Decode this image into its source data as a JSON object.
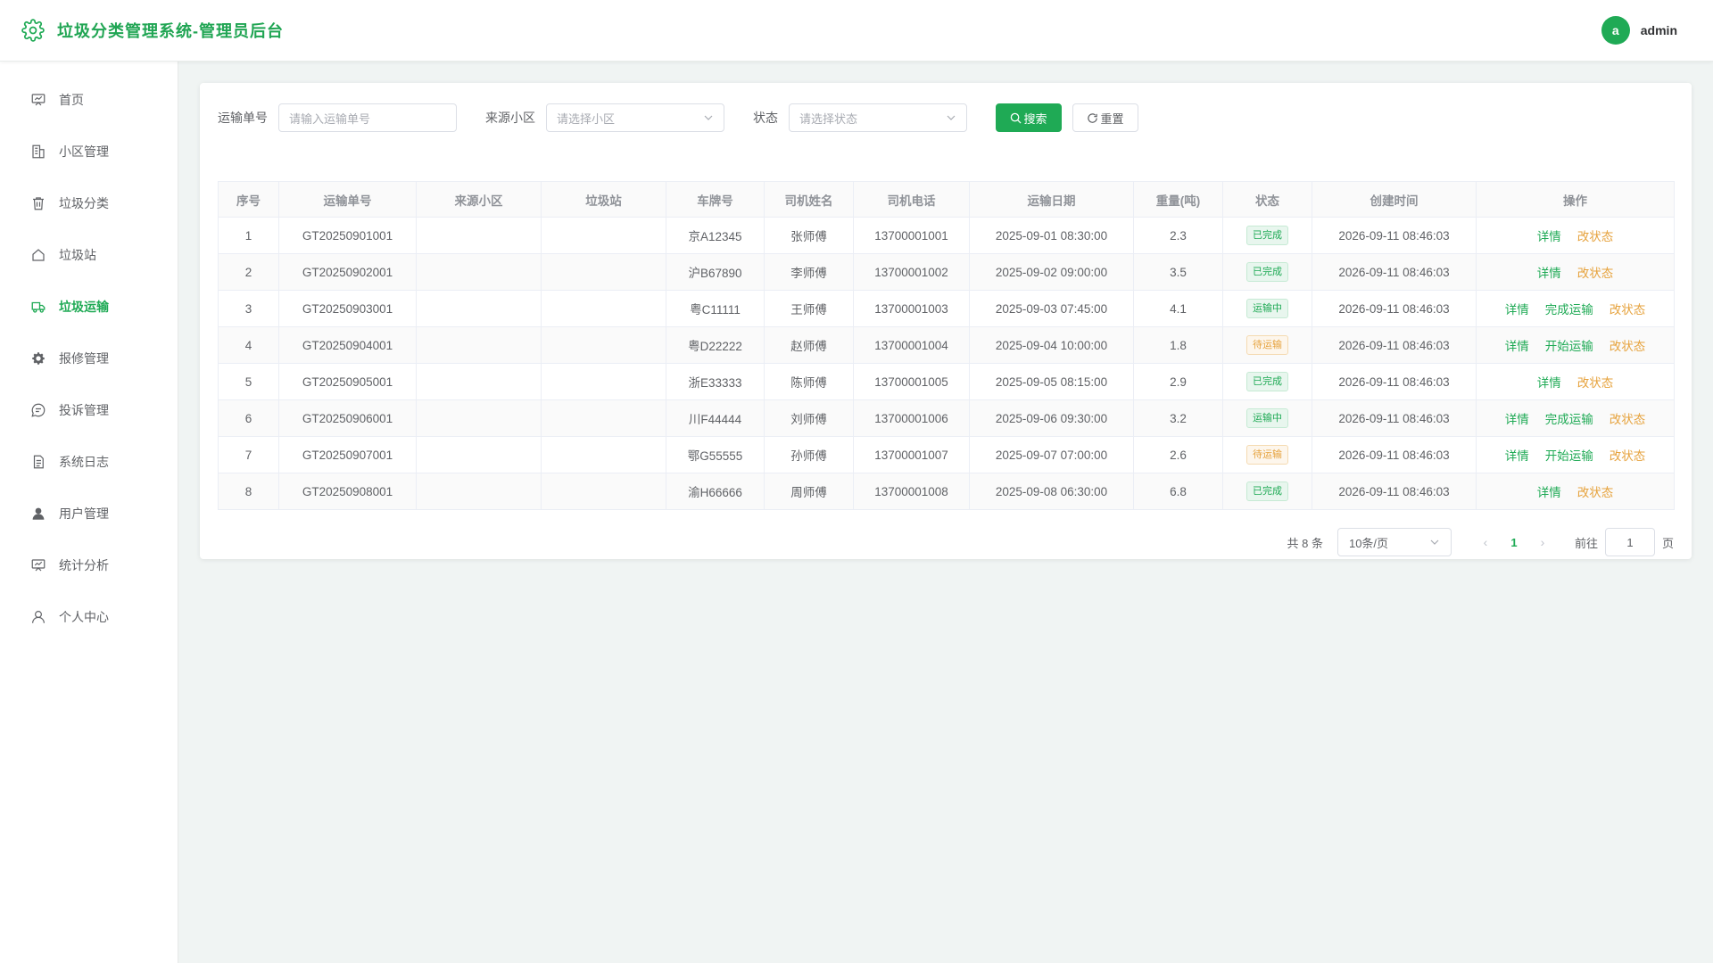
{
  "header": {
    "title": "垃圾分类管理系统-管理员后台",
    "user_initial": "a",
    "username": "admin"
  },
  "sidebar": {
    "items": [
      {
        "label": "首页",
        "icon": "dashboard-icon"
      },
      {
        "label": "小区管理",
        "icon": "building-icon"
      },
      {
        "label": "垃圾分类",
        "icon": "trash-icon"
      },
      {
        "label": "垃圾站",
        "icon": "house-icon"
      },
      {
        "label": "垃圾运输",
        "icon": "truck-icon",
        "active": true
      },
      {
        "label": "报修管理",
        "icon": "gear-icon"
      },
      {
        "label": "投诉管理",
        "icon": "chat-icon"
      },
      {
        "label": "系统日志",
        "icon": "document-icon"
      },
      {
        "label": "用户管理",
        "icon": "user-filled-icon"
      },
      {
        "label": "统计分析",
        "icon": "chart-icon"
      },
      {
        "label": "个人中心",
        "icon": "user-icon"
      }
    ]
  },
  "filters": {
    "transport_no_label": "运输单号",
    "transport_no_placeholder": "请输入运输单号",
    "community_label": "来源小区",
    "community_placeholder": "请选择小区",
    "status_label": "状态",
    "status_placeholder": "请选择状态",
    "search_label": "搜索",
    "reset_label": "重置"
  },
  "table": {
    "columns": [
      "序号",
      "运输单号",
      "来源小区",
      "垃圾站",
      "车牌号",
      "司机姓名",
      "司机电话",
      "运输日期",
      "重量(吨)",
      "状态",
      "创建时间",
      "操作"
    ],
    "rows": [
      {
        "no": "1",
        "order": "GT20250901001",
        "community": "",
        "station": "",
        "plate": "京A12345",
        "driver": "张师傅",
        "phone": "13700001001",
        "date": "2025-09-01 08:30:00",
        "weight": "2.3",
        "status": "已完成",
        "status_type": "done",
        "created": "2026-09-11 08:46:03",
        "ops": [
          "详情",
          "改状态"
        ]
      },
      {
        "no": "2",
        "order": "GT20250902001",
        "community": "",
        "station": "",
        "plate": "沪B67890",
        "driver": "李师傅",
        "phone": "13700001002",
        "date": "2025-09-02 09:00:00",
        "weight": "3.5",
        "status": "已完成",
        "status_type": "done",
        "created": "2026-09-11 08:46:03",
        "ops": [
          "详情",
          "改状态"
        ]
      },
      {
        "no": "3",
        "order": "GT20250903001",
        "community": "",
        "station": "",
        "plate": "粤C11111",
        "driver": "王师傅",
        "phone": "13700001003",
        "date": "2025-09-03 07:45:00",
        "weight": "4.1",
        "status": "运输中",
        "status_type": "moving",
        "created": "2026-09-11 08:46:03",
        "ops": [
          "详情",
          "完成运输",
          "改状态"
        ]
      },
      {
        "no": "4",
        "order": "GT20250904001",
        "community": "",
        "station": "",
        "plate": "粤D22222",
        "driver": "赵师傅",
        "phone": "13700001004",
        "date": "2025-09-04 10:00:00",
        "weight": "1.8",
        "status": "待运输",
        "status_type": "wait",
        "created": "2026-09-11 08:46:03",
        "ops": [
          "详情",
          "开始运输",
          "改状态"
        ]
      },
      {
        "no": "5",
        "order": "GT20250905001",
        "community": "",
        "station": "",
        "plate": "浙E33333",
        "driver": "陈师傅",
        "phone": "13700001005",
        "date": "2025-09-05 08:15:00",
        "weight": "2.9",
        "status": "已完成",
        "status_type": "done",
        "created": "2026-09-11 08:46:03",
        "ops": [
          "详情",
          "改状态"
        ]
      },
      {
        "no": "6",
        "order": "GT20250906001",
        "community": "",
        "station": "",
        "plate": "川F44444",
        "driver": "刘师傅",
        "phone": "13700001006",
        "date": "2025-09-06 09:30:00",
        "weight": "3.2",
        "status": "运输中",
        "status_type": "moving",
        "created": "2026-09-11 08:46:03",
        "ops": [
          "详情",
          "完成运输",
          "改状态"
        ]
      },
      {
        "no": "7",
        "order": "GT20250907001",
        "community": "",
        "station": "",
        "plate": "鄂G55555",
        "driver": "孙师傅",
        "phone": "13700001007",
        "date": "2025-09-07 07:00:00",
        "weight": "2.6",
        "status": "待运输",
        "status_type": "wait",
        "created": "2026-09-11 08:46:03",
        "ops": [
          "详情",
          "开始运输",
          "改状态"
        ]
      },
      {
        "no": "8",
        "order": "GT20250908001",
        "community": "",
        "station": "",
        "plate": "渝H66666",
        "driver": "周师傅",
        "phone": "13700001008",
        "date": "2025-09-08 06:30:00",
        "weight": "6.8",
        "status": "已完成",
        "status_type": "done",
        "created": "2026-09-11 08:46:03",
        "ops": [
          "详情",
          "改状态"
        ]
      }
    ]
  },
  "pagination": {
    "total_text": "共 8 条",
    "page_size": "10条/页",
    "current_page": "1",
    "goto_prefix": "前往",
    "goto_value": "1",
    "goto_suffix": "页"
  },
  "colors": {
    "primary": "#1faa55",
    "warning": "#e6a23c"
  }
}
